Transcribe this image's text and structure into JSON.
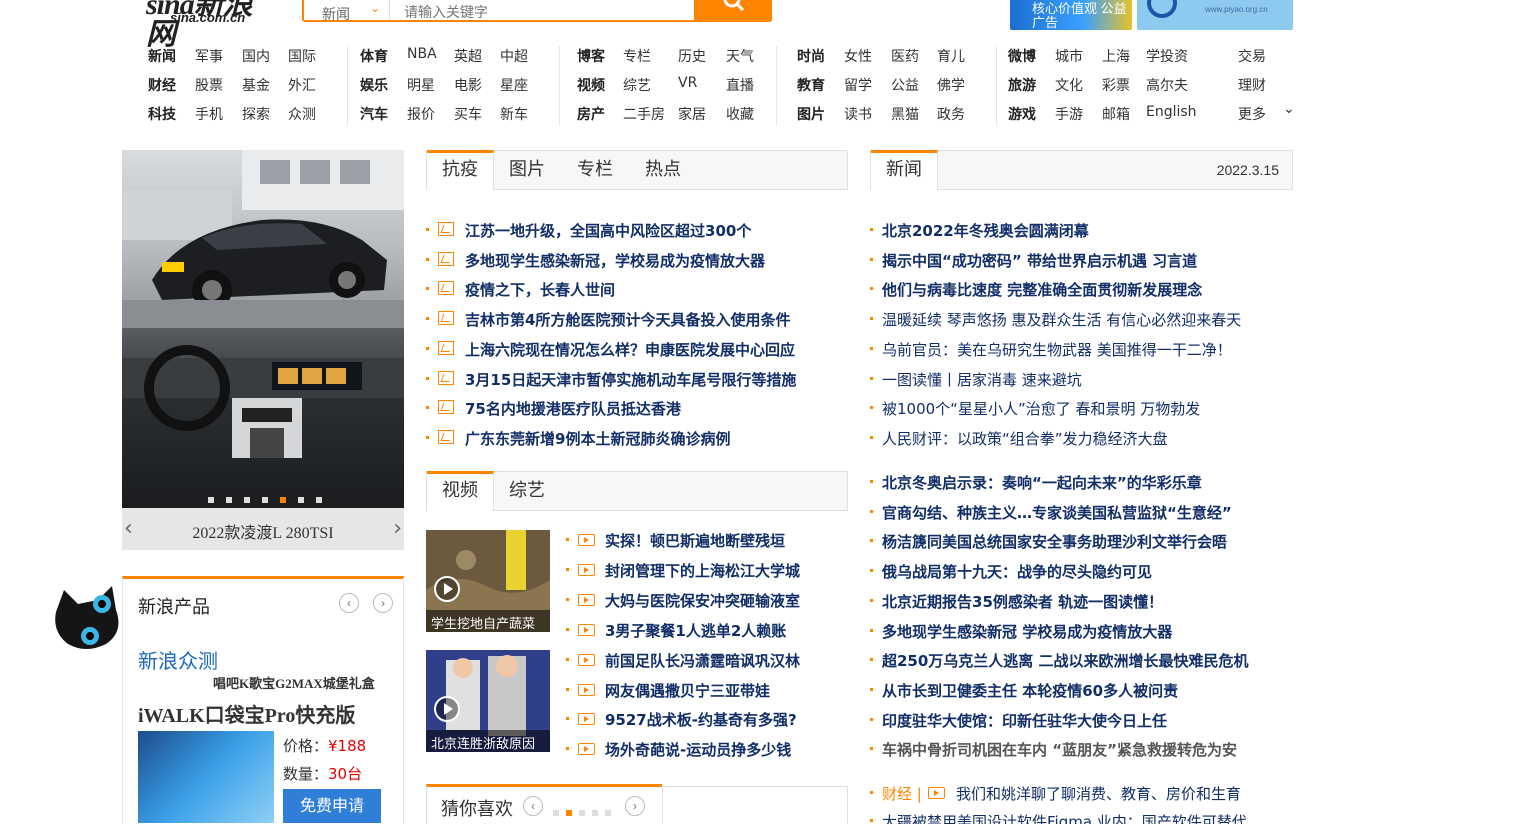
{
  "header": {
    "logo_main": "sina新浪网",
    "logo_sub": "sina.com.cn",
    "search_scope": "新闻",
    "search_placeholder": "请输入关键字",
    "ad1_text": "核心价值观 公益广告"
  },
  "nav": {
    "groups": [
      {
        "rows": [
          [
            "新闻",
            "军事",
            "国内",
            "国际"
          ],
          [
            "财经",
            "股票",
            "基金",
            "外汇"
          ],
          [
            "科技",
            "手机",
            "探索",
            "众测"
          ]
        ]
      },
      {
        "rows": [
          [
            "体育",
            "NBA",
            "英超",
            "中超"
          ],
          [
            "娱乐",
            "明星",
            "电影",
            "星座"
          ],
          [
            "汽车",
            "报价",
            "买车",
            "新车"
          ]
        ]
      },
      {
        "rows": [
          [
            "博客",
            "专栏",
            "历史",
            "天气"
          ],
          [
            "视频",
            "综艺",
            "VR",
            "直播"
          ],
          [
            "房产",
            "二手房",
            "家居",
            "收藏"
          ]
        ]
      },
      {
        "rows": [
          [
            "时尚",
            "女性",
            "医药",
            "育儿"
          ],
          [
            "教育",
            "留学",
            "公益",
            "佛学"
          ],
          [
            "图片",
            "读书",
            "黑猫",
            "政务"
          ]
        ]
      },
      {
        "rows": [
          [
            "微博",
            "城市",
            "上海",
            "学投资"
          ],
          [
            "旅游",
            "文化",
            "彩票",
            "高尔夫"
          ],
          [
            "游戏",
            "手游",
            "邮箱",
            "English"
          ]
        ]
      },
      {
        "rows": [
          [
            "交易"
          ],
          [
            "理财"
          ],
          [
            "更多"
          ]
        ]
      }
    ]
  },
  "slider": {
    "caption": "2022款凌渡L 280TSI",
    "prev_icon": "chevron-left-icon",
    "next_icon": "chevron-right-icon",
    "dot_count": 7,
    "active_dot": 4
  },
  "products": {
    "title": "新浪产品",
    "brand": "新浪众测",
    "subtitle": "唱吧K歌宝G2MAX城堡礼盒",
    "name": "iWALK口袋宝Pro快充版",
    "price_label": "价格：",
    "price": "¥188",
    "qty_label": "数量：",
    "qty": "30台",
    "apply": "免费申请"
  },
  "tabs1": [
    "抗疫",
    "图片",
    "专栏",
    "热点"
  ],
  "news1": [
    "江苏一地升级，全国高中风险区超过300个",
    "多地现学生感染新冠，学校易成为疫情放大器",
    "疫情之下，长春人世间",
    "吉林市第4所方舱医院预计今天具备投入使用条件",
    "上海六院现在情况怎么样？申康医院发展中心回应",
    "3月15日起天津市暂停实施机动车尾号限行等措施",
    "75名内地援港医疗队员抵达香港",
    "广东东莞新增9例本土新冠肺炎确诊病例"
  ],
  "tabs2": [
    "视频",
    "综艺"
  ],
  "videos": [
    {
      "caption": "学生挖地自产蔬菜"
    },
    {
      "caption": "北京连胜浙敌原因"
    }
  ],
  "video_news": [
    "实探！顿巴斯遍地断壁残垣",
    "封闭管理下的上海松江大学城",
    "大妈与医院保安冲突砸输液室",
    "3男子聚餐1人逃单2人赖账",
    "前国足队长冯潇霆暗讽巩汉林",
    "网友偶遇撒贝宁三亚带娃",
    "9527战术板-约基奇有多强?",
    "场外奇葩说-运动员挣多少钱"
  ],
  "guess": {
    "title": "猜你喜欢",
    "dot_count": 5,
    "active_dot": 1
  },
  "news_tab": {
    "label": "新闻",
    "date": "2022.3.15"
  },
  "news2": [
    {
      "t": "北京2022年冬残奥会圆满闭幕",
      "bold": true
    },
    {
      "t": "揭示中国“成功密码” 带给世界启示机遇 习言道",
      "bold": true
    },
    {
      "t": "他们与病毒比速度 完整准确全面贯彻新发展理念",
      "bold": true
    },
    {
      "t": "温暖延续 琴声悠扬 惠及群众生活 有信心必然迎来春天",
      "bold": false
    },
    {
      "t": "乌前官员：美在乌研究生物武器 美国推得一干二净！",
      "bold": false
    },
    {
      "t": "一图读懂丨居家消毒 速来避坑",
      "bold": false
    },
    {
      "t": "被1000个“星星小人”治愈了 春和景明 万物勃发",
      "bold": false
    },
    {
      "t": "人民财评：以政策“组合拳”发力稳经济大盘",
      "bold": false
    }
  ],
  "news3": [
    "北京冬奥启示录：奏响“一起向未来”的华彩乐章",
    "官商勾结、种族主义…专家谈美国私营监狱“生意经”",
    "杨洁篪同美国总统国家安全事务助理沙利文举行会晤",
    "俄乌战局第十九天：战争的尽头隐约可见",
    "北京近期报告35例感染者 轨迹一图读懂！",
    "多地现学生感染新冠 学校易成为疫情放大器",
    "超250万乌克兰人逃离 二战以来欧洲增长最快难民危机",
    "从市长到卫健委主任 本轮疫情60多人被问责",
    "印度驻华大使馆：印新任驻华大使今日上任",
    "车祸中骨折司机困在车内 “蓝朋友”紧急救援转危为安"
  ],
  "finance": {
    "label": "财经 |",
    "items": [
      "我们和姚洋聊了聊消费、教育、房价和生育",
      "大疆被禁用美国设计软件Figma 业内：国产软件可替代"
    ]
  }
}
